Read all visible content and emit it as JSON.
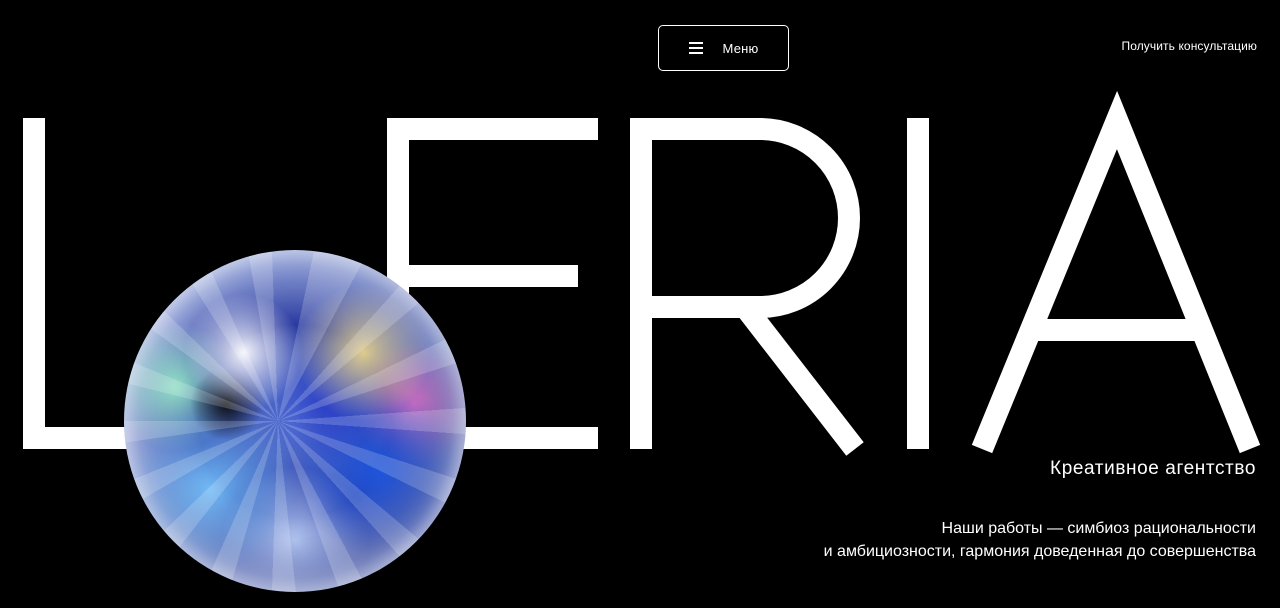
{
  "header": {
    "menu_label": "Меню",
    "menu_icon": "hamburger-icon",
    "consult_link": "Получить консультацию"
  },
  "hero": {
    "logotype": "LOERIA",
    "subtitle": "Креативное агентство",
    "description_line1": "Наши работы — симбиоз рациональности",
    "description_line2": "и амбициозности, гармония доведенная до совершенства",
    "orb_image": "holographic-sphere"
  },
  "colors": {
    "background": "#000000",
    "foreground": "#ffffff"
  }
}
